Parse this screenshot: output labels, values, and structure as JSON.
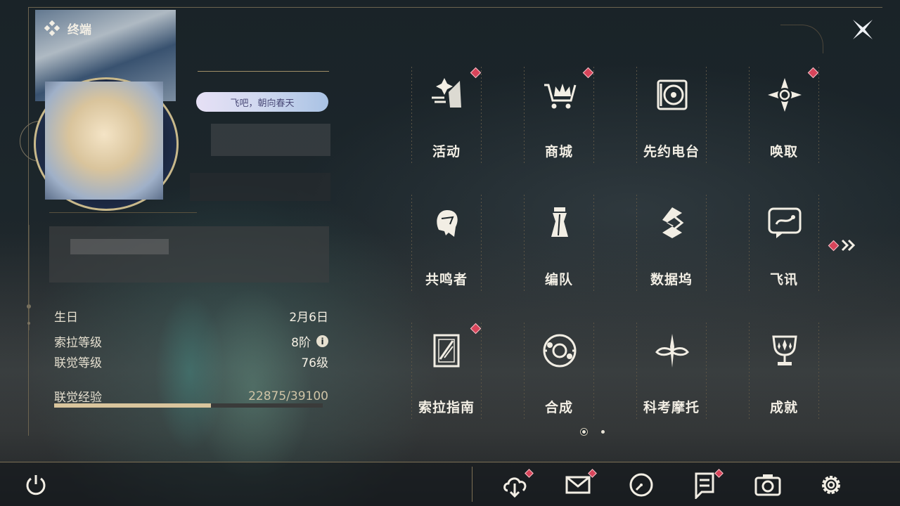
{
  "header": {
    "title": "终端",
    "title_icon": "diamond-cluster-icon",
    "close_icon": "close-x-icon"
  },
  "profile": {
    "tag_text": "飞吧，朝向春天",
    "info": [
      {
        "key": "生日",
        "value": "2月6日"
      },
      {
        "key": "索拉等级",
        "value": "8阶",
        "has_info_icon": true
      },
      {
        "key": "联觉等级",
        "value": "76级"
      },
      {
        "key": "联觉经验",
        "value": "22875/39100"
      }
    ],
    "exp_progress": 0.585
  },
  "menu": {
    "items": [
      {
        "label": "活动",
        "icon": "activity-sparkle-icon",
        "badge": true
      },
      {
        "label": "商城",
        "icon": "shop-cart-icon",
        "badge": true
      },
      {
        "label": "先约电台",
        "icon": "radio-record-icon",
        "badge": false
      },
      {
        "label": "唤取",
        "icon": "convene-compass-icon",
        "badge": true
      },
      {
        "label": "共鸣者",
        "icon": "resonator-head-icon",
        "badge": false
      },
      {
        "label": "编队",
        "icon": "team-chess-icon",
        "badge": false
      },
      {
        "label": "数据坞",
        "icon": "data-bank-icon",
        "badge": false
      },
      {
        "label": "飞讯",
        "icon": "chat-message-icon",
        "badge": false
      },
      {
        "label": "索拉指南",
        "icon": "guide-book-icon",
        "badge": true
      },
      {
        "label": "合成",
        "icon": "synthesis-icon",
        "badge": false
      },
      {
        "label": "科考摩托",
        "icon": "motorcycle-icon",
        "badge": false
      },
      {
        "label": "成就",
        "icon": "trophy-icon",
        "badge": false
      }
    ],
    "next_page_icon": "double-chevron-right-icon",
    "next_page_badge": true,
    "pages": 2,
    "current_page": 1
  },
  "toolbar": {
    "power_icon": "power-icon",
    "items": [
      {
        "icon": "download-cloud-icon",
        "badge": true
      },
      {
        "icon": "mail-icon",
        "badge": true
      },
      {
        "icon": "clock-icon",
        "badge": false
      },
      {
        "icon": "notice-icon",
        "badge": true
      },
      {
        "icon": "camera-icon",
        "badge": false
      },
      {
        "icon": "settings-gear-icon",
        "badge": false
      }
    ]
  },
  "colors": {
    "accent": "#d9c59d",
    "badge": "#d8445a",
    "frame": "#6d6450"
  }
}
